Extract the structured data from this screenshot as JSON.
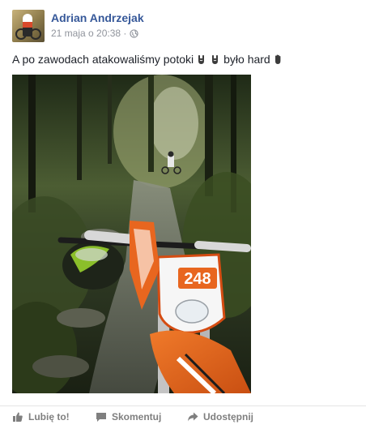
{
  "post": {
    "author": "Adrian Andrzejak",
    "timestamp": "21 maja o 20:38 ·",
    "privacy_icon": "globe-icon",
    "text": "A po zawodach atakowaliśmy potoki",
    "text_tail": "było hard",
    "emojis": [
      "rock-hand-emoji",
      "rock-hand-emoji",
      "waving-hand-emoji"
    ],
    "photo": {
      "description_icon": "motocross-photo",
      "race_number": "248"
    }
  },
  "actions": {
    "like_label": "Lubię to!",
    "comment_label": "Skomentuj",
    "share_label": "Udostępnij"
  },
  "colors": {
    "author_link": "#365899",
    "meta_text": "#90949c",
    "action_text": "#7f7f7f",
    "bike_orange": "#e8661f"
  }
}
